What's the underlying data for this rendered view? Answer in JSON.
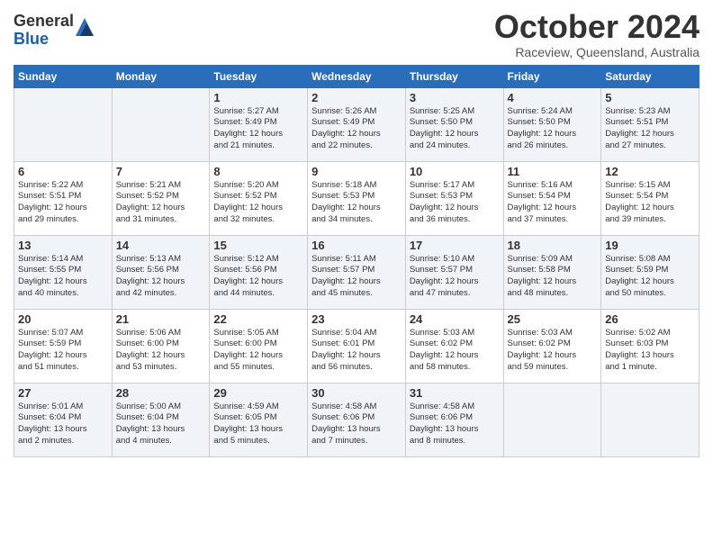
{
  "logo": {
    "general": "General",
    "blue": "Blue"
  },
  "header": {
    "month": "October 2024",
    "location": "Raceview, Queensland, Australia"
  },
  "weekdays": [
    "Sunday",
    "Monday",
    "Tuesday",
    "Wednesday",
    "Thursday",
    "Friday",
    "Saturday"
  ],
  "weeks": [
    [
      {
        "day": "",
        "info": ""
      },
      {
        "day": "",
        "info": ""
      },
      {
        "day": "1",
        "info": "Sunrise: 5:27 AM\nSunset: 5:49 PM\nDaylight: 12 hours\nand 21 minutes."
      },
      {
        "day": "2",
        "info": "Sunrise: 5:26 AM\nSunset: 5:49 PM\nDaylight: 12 hours\nand 22 minutes."
      },
      {
        "day": "3",
        "info": "Sunrise: 5:25 AM\nSunset: 5:50 PM\nDaylight: 12 hours\nand 24 minutes."
      },
      {
        "day": "4",
        "info": "Sunrise: 5:24 AM\nSunset: 5:50 PM\nDaylight: 12 hours\nand 26 minutes."
      },
      {
        "day": "5",
        "info": "Sunrise: 5:23 AM\nSunset: 5:51 PM\nDaylight: 12 hours\nand 27 minutes."
      }
    ],
    [
      {
        "day": "6",
        "info": "Sunrise: 5:22 AM\nSunset: 5:51 PM\nDaylight: 12 hours\nand 29 minutes."
      },
      {
        "day": "7",
        "info": "Sunrise: 5:21 AM\nSunset: 5:52 PM\nDaylight: 12 hours\nand 31 minutes."
      },
      {
        "day": "8",
        "info": "Sunrise: 5:20 AM\nSunset: 5:52 PM\nDaylight: 12 hours\nand 32 minutes."
      },
      {
        "day": "9",
        "info": "Sunrise: 5:18 AM\nSunset: 5:53 PM\nDaylight: 12 hours\nand 34 minutes."
      },
      {
        "day": "10",
        "info": "Sunrise: 5:17 AM\nSunset: 5:53 PM\nDaylight: 12 hours\nand 36 minutes."
      },
      {
        "day": "11",
        "info": "Sunrise: 5:16 AM\nSunset: 5:54 PM\nDaylight: 12 hours\nand 37 minutes."
      },
      {
        "day": "12",
        "info": "Sunrise: 5:15 AM\nSunset: 5:54 PM\nDaylight: 12 hours\nand 39 minutes."
      }
    ],
    [
      {
        "day": "13",
        "info": "Sunrise: 5:14 AM\nSunset: 5:55 PM\nDaylight: 12 hours\nand 40 minutes."
      },
      {
        "day": "14",
        "info": "Sunrise: 5:13 AM\nSunset: 5:56 PM\nDaylight: 12 hours\nand 42 minutes."
      },
      {
        "day": "15",
        "info": "Sunrise: 5:12 AM\nSunset: 5:56 PM\nDaylight: 12 hours\nand 44 minutes."
      },
      {
        "day": "16",
        "info": "Sunrise: 5:11 AM\nSunset: 5:57 PM\nDaylight: 12 hours\nand 45 minutes."
      },
      {
        "day": "17",
        "info": "Sunrise: 5:10 AM\nSunset: 5:57 PM\nDaylight: 12 hours\nand 47 minutes."
      },
      {
        "day": "18",
        "info": "Sunrise: 5:09 AM\nSunset: 5:58 PM\nDaylight: 12 hours\nand 48 minutes."
      },
      {
        "day": "19",
        "info": "Sunrise: 5:08 AM\nSunset: 5:59 PM\nDaylight: 12 hours\nand 50 minutes."
      }
    ],
    [
      {
        "day": "20",
        "info": "Sunrise: 5:07 AM\nSunset: 5:59 PM\nDaylight: 12 hours\nand 51 minutes."
      },
      {
        "day": "21",
        "info": "Sunrise: 5:06 AM\nSunset: 6:00 PM\nDaylight: 12 hours\nand 53 minutes."
      },
      {
        "day": "22",
        "info": "Sunrise: 5:05 AM\nSunset: 6:00 PM\nDaylight: 12 hours\nand 55 minutes."
      },
      {
        "day": "23",
        "info": "Sunrise: 5:04 AM\nSunset: 6:01 PM\nDaylight: 12 hours\nand 56 minutes."
      },
      {
        "day": "24",
        "info": "Sunrise: 5:03 AM\nSunset: 6:02 PM\nDaylight: 12 hours\nand 58 minutes."
      },
      {
        "day": "25",
        "info": "Sunrise: 5:03 AM\nSunset: 6:02 PM\nDaylight: 12 hours\nand 59 minutes."
      },
      {
        "day": "26",
        "info": "Sunrise: 5:02 AM\nSunset: 6:03 PM\nDaylight: 13 hours\nand 1 minute."
      }
    ],
    [
      {
        "day": "27",
        "info": "Sunrise: 5:01 AM\nSunset: 6:04 PM\nDaylight: 13 hours\nand 2 minutes."
      },
      {
        "day": "28",
        "info": "Sunrise: 5:00 AM\nSunset: 6:04 PM\nDaylight: 13 hours\nand 4 minutes."
      },
      {
        "day": "29",
        "info": "Sunrise: 4:59 AM\nSunset: 6:05 PM\nDaylight: 13 hours\nand 5 minutes."
      },
      {
        "day": "30",
        "info": "Sunrise: 4:58 AM\nSunset: 6:06 PM\nDaylight: 13 hours\nand 7 minutes."
      },
      {
        "day": "31",
        "info": "Sunrise: 4:58 AM\nSunset: 6:06 PM\nDaylight: 13 hours\nand 8 minutes."
      },
      {
        "day": "",
        "info": ""
      },
      {
        "day": "",
        "info": ""
      }
    ]
  ]
}
